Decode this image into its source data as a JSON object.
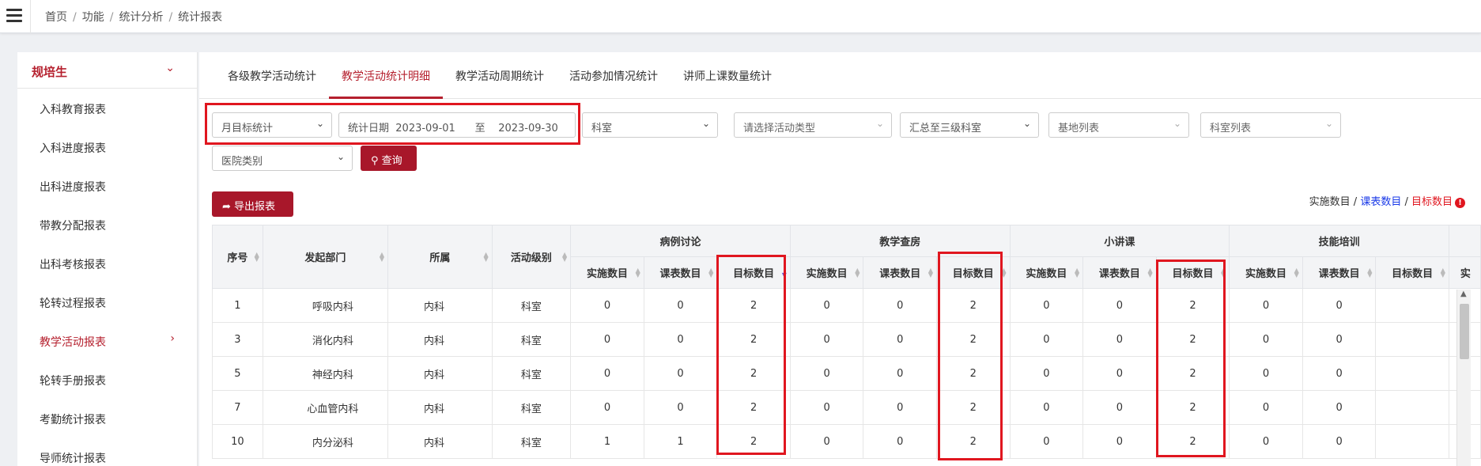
{
  "breadcrumb": [
    "首页",
    "功能",
    "统计分析",
    "统计报表"
  ],
  "sidebar": {
    "title": "规培生",
    "items": [
      {
        "label": "入科教育报表"
      },
      {
        "label": "入科进度报表"
      },
      {
        "label": "出科进度报表"
      },
      {
        "label": "带教分配报表"
      },
      {
        "label": "出科考核报表"
      },
      {
        "label": "轮转过程报表"
      },
      {
        "label": "教学活动报表",
        "active": true
      },
      {
        "label": "轮转手册报表"
      },
      {
        "label": "考勤统计报表"
      },
      {
        "label": "导师统计报表"
      }
    ]
  },
  "tabs": [
    "各级教学活动统计",
    "教学活动统计明细",
    "教学活动周期统计",
    "活动参加情况统计",
    "讲师上课数量统计"
  ],
  "active_tab": "教学活动统计明细",
  "filters": {
    "stat_type": "月目标统计",
    "date_label": "统计日期",
    "date_start": "2023-09-01",
    "date_to": "至",
    "date_end": "2023-09-30",
    "dept": "科室",
    "activity_type": "请选择活动类型",
    "summary_level": "汇总至三级科室",
    "base_list": "基地列表",
    "dept_list": "科室列表",
    "hospital_type": "医院类别",
    "query": "查询"
  },
  "export_label": "导出报表",
  "legend": {
    "impl": "实施数目",
    "sep": " / ",
    "sched": "课表数目",
    "target": "目标数目"
  },
  "colors": {
    "accent": "#b5202e",
    "button": "#a8172a",
    "blue": "#1a3ae8",
    "red": "#e0161f"
  },
  "table": {
    "fixed_headers": [
      "序号",
      "发起部门",
      "所属",
      "活动级别"
    ],
    "groups": [
      "病例讨论",
      "教学查房",
      "小讲课",
      "技能培训"
    ],
    "sub_headers": [
      "实施数目",
      "课表数目",
      "目标数目"
    ],
    "last_partial": "实",
    "rows": [
      {
        "no": "1",
        "dept": "呼吸内科",
        "belong": "内科",
        "level": "科室",
        "vals": [
          "0",
          "0",
          "2",
          "0",
          "0",
          "2",
          "0",
          "0",
          "2",
          "0",
          "0",
          ""
        ]
      },
      {
        "no": "3",
        "dept": "消化内科",
        "belong": "内科",
        "level": "科室",
        "vals": [
          "0",
          "0",
          "2",
          "0",
          "0",
          "2",
          "0",
          "0",
          "2",
          "0",
          "0",
          ""
        ]
      },
      {
        "no": "5",
        "dept": "神经内科",
        "belong": "内科",
        "level": "科室",
        "vals": [
          "0",
          "0",
          "2",
          "0",
          "0",
          "2",
          "0",
          "0",
          "2",
          "0",
          "0",
          ""
        ]
      },
      {
        "no": "7",
        "dept": "心血管内科",
        "belong": "内科",
        "level": "科室",
        "vals": [
          "0",
          "0",
          "2",
          "0",
          "0",
          "2",
          "0",
          "0",
          "2",
          "0",
          "0",
          ""
        ]
      },
      {
        "no": "10",
        "dept": "内分泌科",
        "belong": "内科",
        "level": "科室",
        "vals": [
          "1",
          "1",
          "2",
          "0",
          "0",
          "2",
          "0",
          "0",
          "2",
          "0",
          "0",
          ""
        ]
      }
    ]
  }
}
